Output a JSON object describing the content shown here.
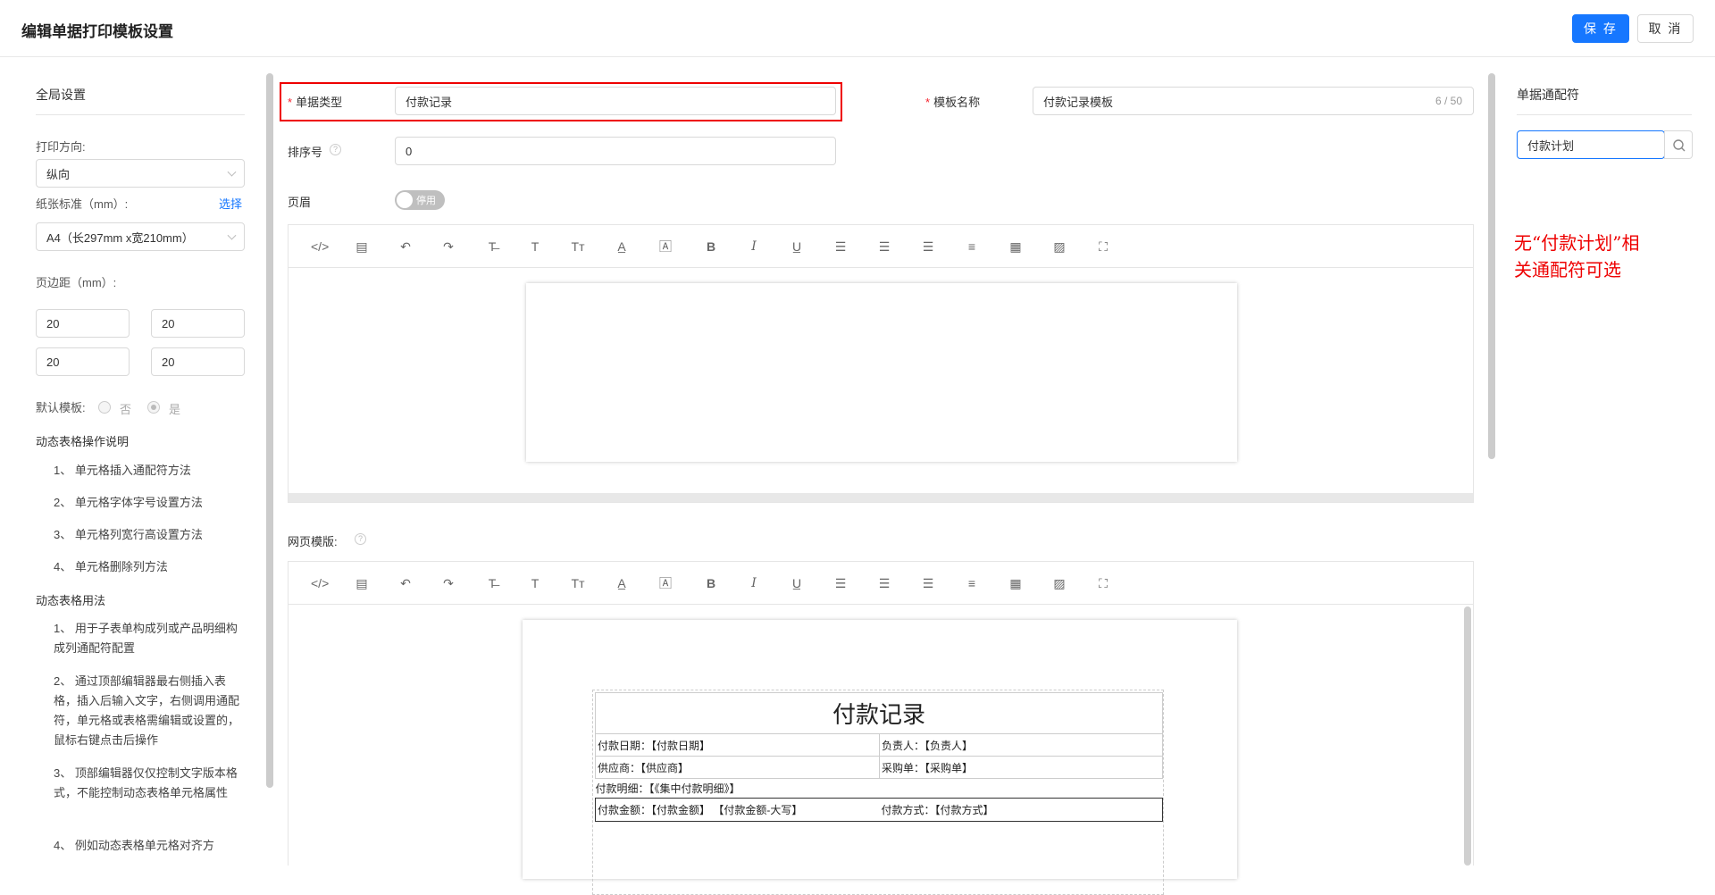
{
  "header": {
    "title": "编辑单据打印模板设置",
    "save_label": "保 存",
    "cancel_label": "取 消"
  },
  "sidebar": {
    "title": "全局设置",
    "print_direction_label": "打印方向:",
    "print_direction_value": "纵向",
    "paper_label": "纸张标准（mm）:",
    "paper_select_link": "选择",
    "paper_value": "A4（长297mm x宽210mm）",
    "margin_label": "页边距（mm）:",
    "margins": [
      "20",
      "20",
      "20",
      "20"
    ],
    "default_template_label": "默认模板:",
    "default_no": "否",
    "default_yes": "是",
    "dynamic_ops_title": "动态表格操作说明",
    "dynamic_ops": [
      "1、 单元格插入通配符方法",
      "2、 单元格字体字号设置方法",
      "3、 单元格列宽行高设置方法",
      "4、 单元格删除列方法"
    ],
    "dynamic_usage_title": "动态表格用法",
    "dynamic_usage": [
      "1、 用于子表单构成列或产品明细构成列通配符配置",
      "2、 通过顶部编辑器最右侧插入表格，插入后输入文字，右侧调用通配符，单元格或表格需编辑或设置的，鼠标右键点击后操作",
      "3、 顶部编辑器仅仅控制文字版本格式，不能控制动态表格单元格属性",
      "4、 例如动态表格单元格对齐方"
    ]
  },
  "form": {
    "doc_type_label": "单据类型",
    "doc_type_value": "付款记录",
    "template_name_label": "模板名称",
    "template_name_value": "付款记录模板",
    "template_name_count": "6 / 50",
    "sort_label": "排序号",
    "sort_value": "0",
    "header_label": "页眉",
    "header_toggle": "停用",
    "web_template_label": "网页模版:"
  },
  "toolbar_icons": [
    "code-icon",
    "template-icon",
    "undo-icon",
    "redo-icon",
    "strikethrough-icon",
    "text-icon",
    "font-size-icon",
    "font-color-icon",
    "background-color-icon",
    "bold-icon",
    "italic-icon",
    "underline-icon",
    "align-left-icon",
    "align-center-icon",
    "align-right-icon",
    "justify-icon",
    "table-icon",
    "image-icon",
    "fullscreen-icon"
  ],
  "toolbar_glyphs": [
    "</>",
    "▤",
    "↶",
    "↷",
    "T̶",
    "T",
    "Tт",
    "A̲",
    "🄰",
    "B",
    "I",
    "U̲",
    "☰",
    "☰",
    "☰",
    "≡",
    "▦",
    "▨",
    "⛶"
  ],
  "doc_template": {
    "title": "付款记录",
    "rows": [
      [
        "付款日期：【付款日期】",
        "负责人：【负责人】"
      ],
      [
        "供应商：【供应商】",
        "采购单：【采购单】"
      ]
    ],
    "detail": "付款明细：【《集中付款明细》】",
    "amount": "付款金额：【付款金额】 【付款金额-大写】",
    "method": "付款方式：【付款方式】"
  },
  "right_panel": {
    "title": "单据通配符",
    "search_value": "付款计划"
  },
  "annotation": {
    "line1": "无“付款计划”相",
    "line2": "关通配符可选"
  },
  "colors": {
    "primary": "#1677ff",
    "highlight": "#e00000"
  }
}
